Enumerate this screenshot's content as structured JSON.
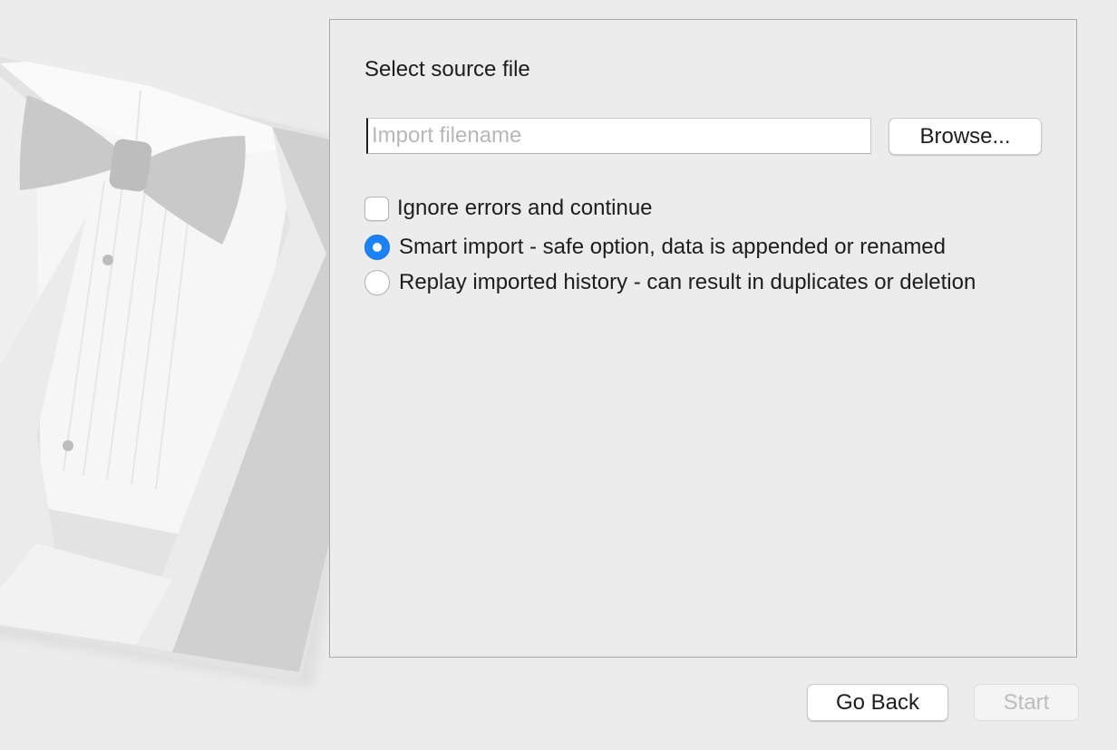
{
  "panel": {
    "title": "Select source file",
    "file_input": {
      "placeholder": "Import filename",
      "value": ""
    },
    "browse_label": "Browse...",
    "ignore_errors": {
      "label": "Ignore errors and continue",
      "checked": false
    },
    "import_mode": {
      "options": [
        {
          "label": "Smart import - safe option, data is appended or renamed",
          "selected": true
        },
        {
          "label": "Replay imported history - can result in duplicates or deletion",
          "selected": false
        }
      ]
    }
  },
  "footer": {
    "go_back_label": "Go Back",
    "start_label": "Start",
    "start_enabled": false
  },
  "illustration": {
    "icon": "tuxedo-icon"
  },
  "colors": {
    "accent": "#1a82fb",
    "background": "#ececec",
    "disabled_text": "#bdbdbd"
  }
}
